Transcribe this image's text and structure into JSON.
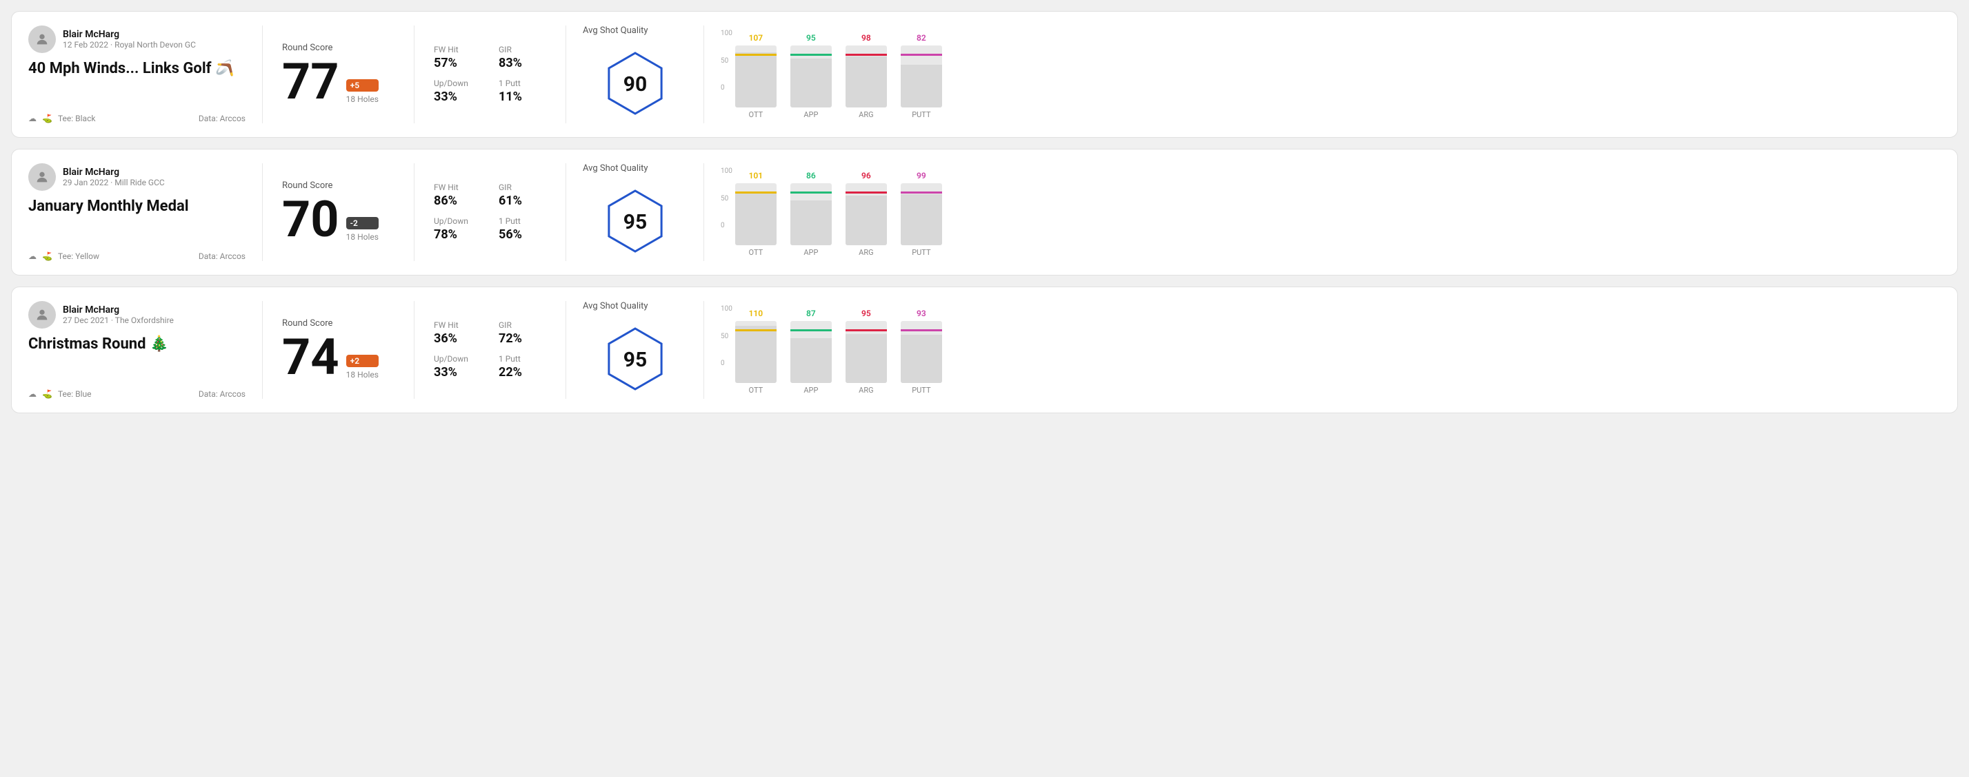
{
  "rounds": [
    {
      "id": "round1",
      "user_name": "Blair McHarg",
      "user_date": "12 Feb 2022 · Royal North Devon GC",
      "round_title": "40 Mph Winds... Links Golf 🪃",
      "tee_color": "Black",
      "data_source": "Data: Arccos",
      "round_score_label": "Round Score",
      "score": "77",
      "score_modifier": "+5",
      "score_modifier_type": "positive",
      "holes": "18 Holes",
      "fw_hit_label": "FW Hit",
      "fw_hit_value": "57%",
      "gir_label": "GIR",
      "gir_value": "83%",
      "updown_label": "Up/Down",
      "updown_value": "33%",
      "oneputt_label": "1 Putt",
      "oneputt_value": "11%",
      "quality_label": "Avg Shot Quality",
      "quality_score": "90",
      "chart": {
        "bars": [
          {
            "label": "OTT",
            "value": 107,
            "color": "#e8b800",
            "max": 120
          },
          {
            "label": "APP",
            "value": 95,
            "color": "#22bb77",
            "max": 120
          },
          {
            "label": "ARG",
            "value": 98,
            "color": "#dd2244",
            "max": 120
          },
          {
            "label": "PUTT",
            "value": 82,
            "color": "#cc44aa",
            "max": 120
          }
        ]
      }
    },
    {
      "id": "round2",
      "user_name": "Blair McHarg",
      "user_date": "29 Jan 2022 · Mill Ride GCC",
      "round_title": "January Monthly Medal",
      "tee_color": "Yellow",
      "data_source": "Data: Arccos",
      "round_score_label": "Round Score",
      "score": "70",
      "score_modifier": "-2",
      "score_modifier_type": "negative",
      "holes": "18 Holes",
      "fw_hit_label": "FW Hit",
      "fw_hit_value": "86%",
      "gir_label": "GIR",
      "gir_value": "61%",
      "updown_label": "Up/Down",
      "updown_value": "78%",
      "oneputt_label": "1 Putt",
      "oneputt_value": "56%",
      "quality_label": "Avg Shot Quality",
      "quality_score": "95",
      "chart": {
        "bars": [
          {
            "label": "OTT",
            "value": 101,
            "color": "#e8b800",
            "max": 120
          },
          {
            "label": "APP",
            "value": 86,
            "color": "#22bb77",
            "max": 120
          },
          {
            "label": "ARG",
            "value": 96,
            "color": "#dd2244",
            "max": 120
          },
          {
            "label": "PUTT",
            "value": 99,
            "color": "#cc44aa",
            "max": 120
          }
        ]
      }
    },
    {
      "id": "round3",
      "user_name": "Blair McHarg",
      "user_date": "27 Dec 2021 · The Oxfordshire",
      "round_title": "Christmas Round 🎄",
      "tee_color": "Blue",
      "data_source": "Data: Arccos",
      "round_score_label": "Round Score",
      "score": "74",
      "score_modifier": "+2",
      "score_modifier_type": "positive",
      "holes": "18 Holes",
      "fw_hit_label": "FW Hit",
      "fw_hit_value": "36%",
      "gir_label": "GIR",
      "gir_value": "72%",
      "updown_label": "Up/Down",
      "updown_value": "33%",
      "oneputt_label": "1 Putt",
      "oneputt_value": "22%",
      "quality_label": "Avg Shot Quality",
      "quality_score": "95",
      "chart": {
        "bars": [
          {
            "label": "OTT",
            "value": 110,
            "color": "#e8b800",
            "max": 120
          },
          {
            "label": "APP",
            "value": 87,
            "color": "#22bb77",
            "max": 120
          },
          {
            "label": "ARG",
            "value": 95,
            "color": "#dd2244",
            "max": 120
          },
          {
            "label": "PUTT",
            "value": 93,
            "color": "#cc44aa",
            "max": 120
          }
        ]
      }
    }
  ]
}
